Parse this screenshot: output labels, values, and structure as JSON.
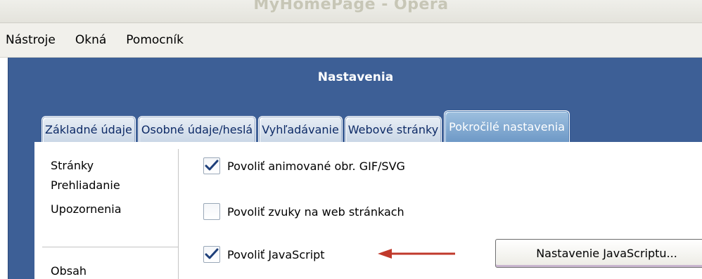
{
  "window": {
    "title": "MyHomePage - Opera"
  },
  "menubar": {
    "items": [
      {
        "label": "Nástroje"
      },
      {
        "label": "Okná"
      },
      {
        "label": "Pomocník"
      }
    ]
  },
  "dialog": {
    "title": "Nastavenia",
    "tabs": [
      {
        "label": "Základné údaje",
        "active": false
      },
      {
        "label": "Osobné údaje/heslá",
        "active": false
      },
      {
        "label": "Vyhľadávanie",
        "active": false
      },
      {
        "label": "Webové stránky",
        "active": false
      },
      {
        "label": "Pokročilé nastavenia",
        "active": true
      }
    ],
    "sidebar": {
      "items": [
        {
          "label": "Stránky"
        },
        {
          "label": "Prehliadanie"
        },
        {
          "label": "Upozornenia"
        },
        {
          "label": "Obsah"
        }
      ]
    },
    "options": [
      {
        "label": "Povoliť animované obr. GIF/SVG",
        "checked": true
      },
      {
        "label": "Povoliť zvuky na web stránkach",
        "checked": false
      },
      {
        "label": "Povoliť JavaScript",
        "checked": true
      }
    ],
    "javascript_button": {
      "label": "Nastavenie JavaScriptu..."
    }
  },
  "colors": {
    "dialog_background": "#3d5f96",
    "arrow": "#c0392b",
    "active_tab": "#7ea6d1"
  },
  "icons": {
    "check": "check-icon",
    "arrow": "arrow-left-icon"
  }
}
